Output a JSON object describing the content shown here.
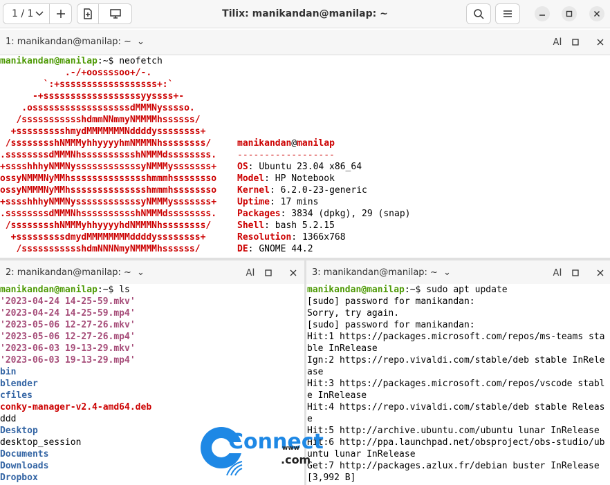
{
  "header": {
    "session_label": "1 / 1",
    "title": "Tilix: manikandan@manilap: ~"
  },
  "panes": [
    {
      "title": "1: manikandan@manilap: ~"
    },
    {
      "title": "2: manikandan@manilap: ~"
    },
    {
      "title": "3: manikandan@manilap: ~"
    }
  ],
  "pane1": {
    "prompt_user": "manikandan@manilap",
    "prompt_path": ":~$ ",
    "command": "neofetch",
    "logo": [
      "            .-/+oossssoo+/-.",
      "        `:+ssssssssssssssssss+:`",
      "      -+ssssssssssssssssssyyssss+-",
      "    .ossssssssssssssssssdMMMNysssso.",
      "   /ssssssssssshdmmNNmmyNMMMMhssssss/",
      "  +ssssssssshmydMMMMMMMNddddyssssssss+",
      " /sssssssshNMMMyhhyyyyhmNMMMNhssssssss/",
      ".ssssssssdMMMNhsssssssssshNMMMdssssssss.",
      "+sssshhhyNMMNyssssssssssssyNMMMysssssss+",
      "ossyNMMMNyMMhsssssssssssssshmmmhssssssso",
      "ossyNMMMNyMMhsssssssssssssshmmmhssssssso",
      "+sssshhhyNMMNyssssssssssssyNMMMysssssss+",
      ".ssssssssdMMMNhsssssssssshNMMMdssssssss.",
      " /sssssssshNMMMyhhyyyyhdNMMMNhssssssss/",
      "  +sssssssssdmydMMMMMMMMddddyssssssss+",
      "   /ssssssssssshdmNNNNmyNMMMMhssssss/"
    ],
    "info_user": "manikandan",
    "info_at": "@",
    "info_host": "manilap",
    "separator": "------------------",
    "info": [
      {
        "key": "OS",
        "value": "Ubuntu 23.04 x86_64"
      },
      {
        "key": "Model",
        "value": "HP Notebook"
      },
      {
        "key": "Kernel",
        "value": "6.2.0-23-generic"
      },
      {
        "key": "Uptime",
        "value": "17 mins"
      },
      {
        "key": "Packages",
        "value": "3834 (dpkg), 29 (snap)"
      },
      {
        "key": "Shell",
        "value": "bash 5.2.15"
      },
      {
        "key": "Resolution",
        "value": "1366x768"
      },
      {
        "key": "DE",
        "value": "GNOME 44.2"
      }
    ]
  },
  "pane2": {
    "prompt_user": "manikandan@manilap",
    "prompt_path": ":~$ ",
    "command": "ls",
    "entries": [
      {
        "name": "'2023-04-24 14-25-59.mkv'",
        "kind": "media"
      },
      {
        "name": "'2023-04-24 14-25-59.mp4'",
        "kind": "media"
      },
      {
        "name": "'2023-05-06 12-27-26.mkv'",
        "kind": "media"
      },
      {
        "name": "'2023-05-06 12-27-26.mp4'",
        "kind": "media"
      },
      {
        "name": "'2023-06-03 19-13-29.mkv'",
        "kind": "media"
      },
      {
        "name": "'2023-06-03 19-13-29.mp4'",
        "kind": "media"
      },
      {
        "name": "bin",
        "kind": "dir"
      },
      {
        "name": "blender",
        "kind": "dir"
      },
      {
        "name": "cfiles",
        "kind": "dir"
      },
      {
        "name": "conky-manager-v2.4-amd64.deb",
        "kind": "archive"
      },
      {
        "name": "ddd",
        "kind": "file"
      },
      {
        "name": "Desktop",
        "kind": "dir"
      },
      {
        "name": "desktop_session",
        "kind": "file"
      },
      {
        "name": "Documents",
        "kind": "dir"
      },
      {
        "name": "Downloads",
        "kind": "dir"
      },
      {
        "name": "Dropbox",
        "kind": "dir"
      }
    ]
  },
  "pane3": {
    "prompt_user": "manikandan@manilap",
    "prompt_path": ":~$ ",
    "command": "sudo apt update",
    "lines": [
      "[sudo] password for manikandan:",
      "Sorry, try again.",
      "[sudo] password for manikandan:",
      "Hit:1 https://packages.microsoft.com/repos/ms-teams sta",
      "ble InRelease",
      "Ign:2 https://repo.vivaldi.com/stable/deb stable InRele",
      "ase",
      "Hit:3 https://packages.microsoft.com/repos/vscode stabl",
      "e InRelease",
      "Hit:4 https://repo.vivaldi.com/stable/deb stable Releas",
      "e",
      "Hit:5 http://archive.ubuntu.com/ubuntu lunar InRelease",
      "Hit:6 http://ppa.launchpad.net/obsproject/obs-studio/ub",
      "untu lunar InRelease",
      "Get:7 http://packages.azlux.fr/debian buster InRelease",
      "[3,992 B]"
    ]
  },
  "watermark": {
    "word": "Connect",
    "sub": "www",
    "dot": ".com"
  },
  "colors": {
    "prompt": "#4e9a06",
    "directory": "#3465a4",
    "archive": "#cc0000",
    "media": "#a64d79",
    "logo": "#cc0000",
    "watermark": "#1e88e5"
  }
}
